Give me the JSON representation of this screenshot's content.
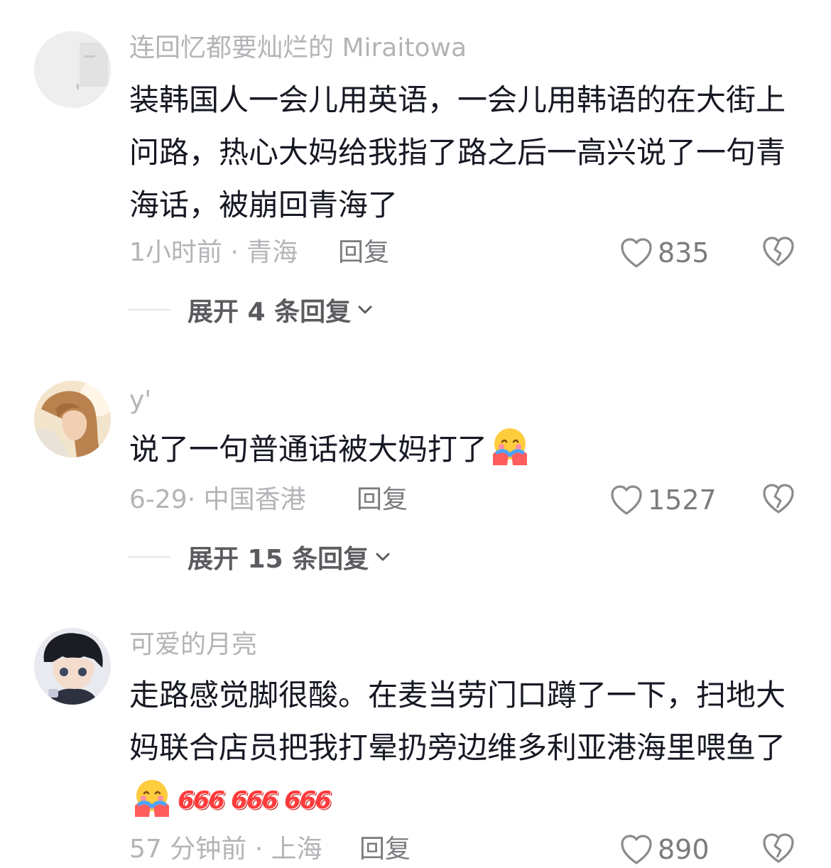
{
  "comments": [
    {
      "username": "连回忆都要灿烂的 Miraitowa",
      "text": "装韩国人一会儿用英语，一会儿用韩语的在大街上问路，热心大妈给我指了路之后一高兴说了一句青海话，被崩回青海了",
      "meta": "1小时前 · 青海",
      "reply_label": "回复",
      "likes": "835",
      "expand_label": "展开 4 条回复",
      "avatar_icon": "avatar-photo-icon"
    },
    {
      "username": "y'",
      "text": "说了一句普通话被大妈打了",
      "meta": "6-29· 中国香港",
      "reply_label": "回复",
      "likes": "1527",
      "expand_label": "展开 15 条回复",
      "avatar_icon": "avatar-anime-girl-icon",
      "emoji": "hugging-face-emoji"
    },
    {
      "username": "可爱的月亮",
      "text": "走路感觉脚很酸。在麦当劳门口蹲了一下，扫地大妈联合店员把我打晕扔旁边维多利亚港海里喂鱼了",
      "meta": "57 分钟前 · 上海",
      "reply_label": "回复",
      "likes": "890",
      "avatar_icon": "avatar-anime-boy-icon",
      "emoji": "hugging-face-emoji",
      "stickers": [
        "666",
        "666",
        "666"
      ]
    }
  ],
  "icons": {
    "like": "heart-outline-icon",
    "dislike": "broken-heart-icon",
    "expand": "chevron-down-icon"
  },
  "colors": {
    "text": "#161823",
    "secondary": "#b4b4b8",
    "action": "#7b7b80",
    "sticker": "#ff3b3b"
  }
}
